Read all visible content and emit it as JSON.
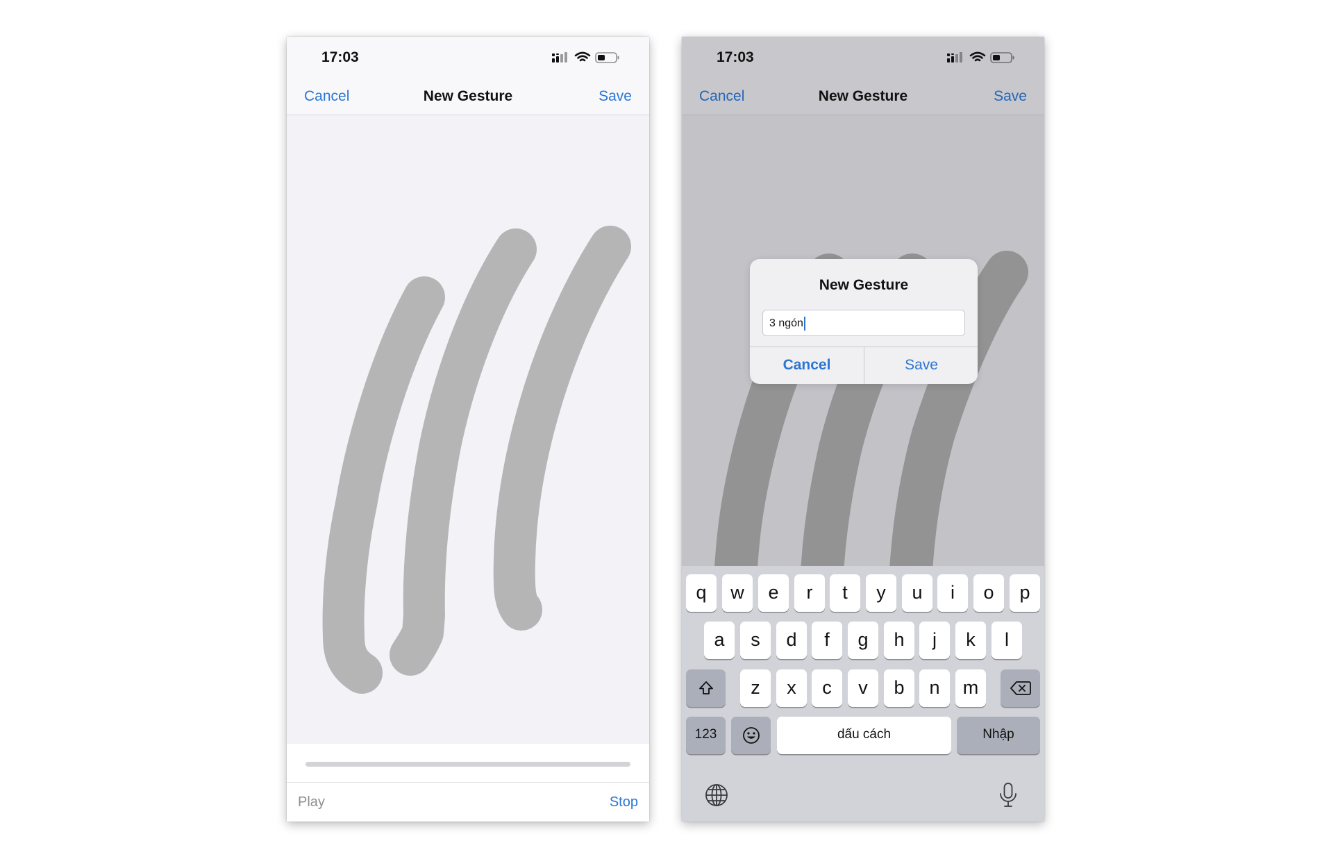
{
  "left_screen": {
    "status": {
      "time": "17:03"
    },
    "nav": {
      "cancel": "Cancel",
      "title": "New Gesture",
      "save": "Save"
    },
    "playback": {
      "play": "Play",
      "stop": "Stop",
      "progress": 1.0
    }
  },
  "right_screen": {
    "status": {
      "time": "17:03"
    },
    "nav": {
      "cancel": "Cancel",
      "title": "New Gesture",
      "save": "Save"
    },
    "dialog": {
      "title": "New Gesture",
      "input_value": "3 ngón",
      "cancel": "Cancel",
      "save": "Save"
    },
    "keyboard": {
      "row1": [
        "q",
        "w",
        "e",
        "r",
        "t",
        "y",
        "u",
        "i",
        "o",
        "p"
      ],
      "row2": [
        "a",
        "s",
        "d",
        "f",
        "g",
        "h",
        "j",
        "k",
        "l"
      ],
      "row3": [
        "z",
        "x",
        "c",
        "v",
        "b",
        "n",
        "m"
      ],
      "numbers_key": "123",
      "space_key": "dấu cách",
      "return_key": "Nhập"
    }
  },
  "colors": {
    "accent": "#2a76d2",
    "stroke_light": "#b5b5b5",
    "stroke_dark": "#939393",
    "keyboard_bg": "#d1d3d9"
  }
}
